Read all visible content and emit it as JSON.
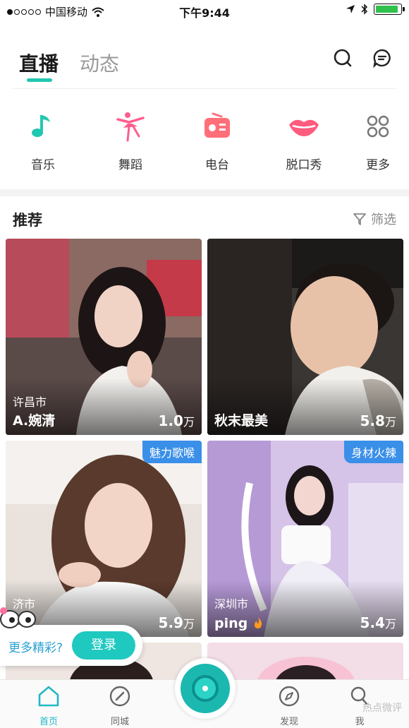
{
  "status_bar": {
    "carrier": "中国移动",
    "time": "下午9:44",
    "battery_level": 0.9
  },
  "header": {
    "tabs": [
      {
        "label": "直播",
        "active": true
      },
      {
        "label": "动态",
        "active": false
      }
    ]
  },
  "categories": [
    {
      "label": "音乐",
      "icon": "music-note-icon",
      "color": "#22c7b0"
    },
    {
      "label": "舞蹈",
      "icon": "dancer-icon",
      "color": "#ff5c8d"
    },
    {
      "label": "电台",
      "icon": "radio-icon",
      "color": "#ff6f7a"
    },
    {
      "label": "脱口秀",
      "icon": "lips-icon",
      "color": "#ff5b7f"
    },
    {
      "label": "更多",
      "icon": "more-grid-icon",
      "color": "#777777"
    }
  ],
  "recommend": {
    "title": "推荐",
    "filter_label": "筛选"
  },
  "cards": [
    {
      "city": "许昌市",
      "name": "A.婉清",
      "viewers": "1.0",
      "unit": "万",
      "tag": ""
    },
    {
      "city": "",
      "name": "秋末最美",
      "viewers": "5.8",
      "unit": "万",
      "tag": ""
    },
    {
      "city": "济市",
      "name": "",
      "viewers": "5.9",
      "unit": "万",
      "tag": "魅力歌喉"
    },
    {
      "city": "深圳市",
      "name": "ping",
      "viewers": "5.4",
      "unit": "万",
      "tag": "身材火辣"
    }
  ],
  "login_prompt": {
    "text": "更多精彩?",
    "button": "登录"
  },
  "bottom_nav": [
    {
      "label": "首页",
      "icon": "home-icon",
      "active": true
    },
    {
      "label": "同城",
      "icon": "compass-icon",
      "active": false
    },
    {
      "label": "发现",
      "icon": "discover-icon",
      "active": false
    },
    {
      "label": "我",
      "icon": "profile-icon",
      "active": false
    }
  ],
  "watermark": "热点微评"
}
